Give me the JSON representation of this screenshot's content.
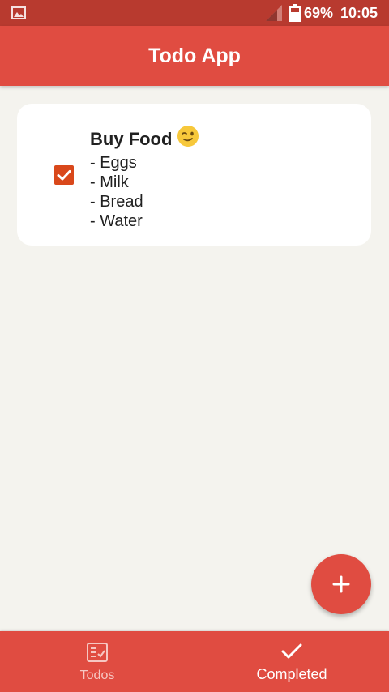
{
  "status_bar": {
    "battery": "69%",
    "time": "10:05",
    "icons": [
      "gallery-icon",
      "signal-icon",
      "battery-icon"
    ]
  },
  "app_bar": {
    "title": "Todo App"
  },
  "todos": [
    {
      "title": "Buy Food",
      "emoji_icon": "winking-face-icon",
      "lines": [
        "- Eggs",
        "- Milk",
        "- Bread",
        "- Water"
      ],
      "completed": true
    }
  ],
  "fab": {
    "icon": "plus-icon"
  },
  "bottom_nav": {
    "items": [
      {
        "label": "Todos",
        "icon": "todo-list-icon",
        "active": false
      },
      {
        "label": "Completed",
        "icon": "checkmark-icon",
        "active": true
      }
    ]
  },
  "colors": {
    "primary": "#e04c41",
    "status_bar": "#b83a2f",
    "background": "#f4f3ee",
    "checkbox": "#d9481b",
    "card": "#ffffff"
  }
}
